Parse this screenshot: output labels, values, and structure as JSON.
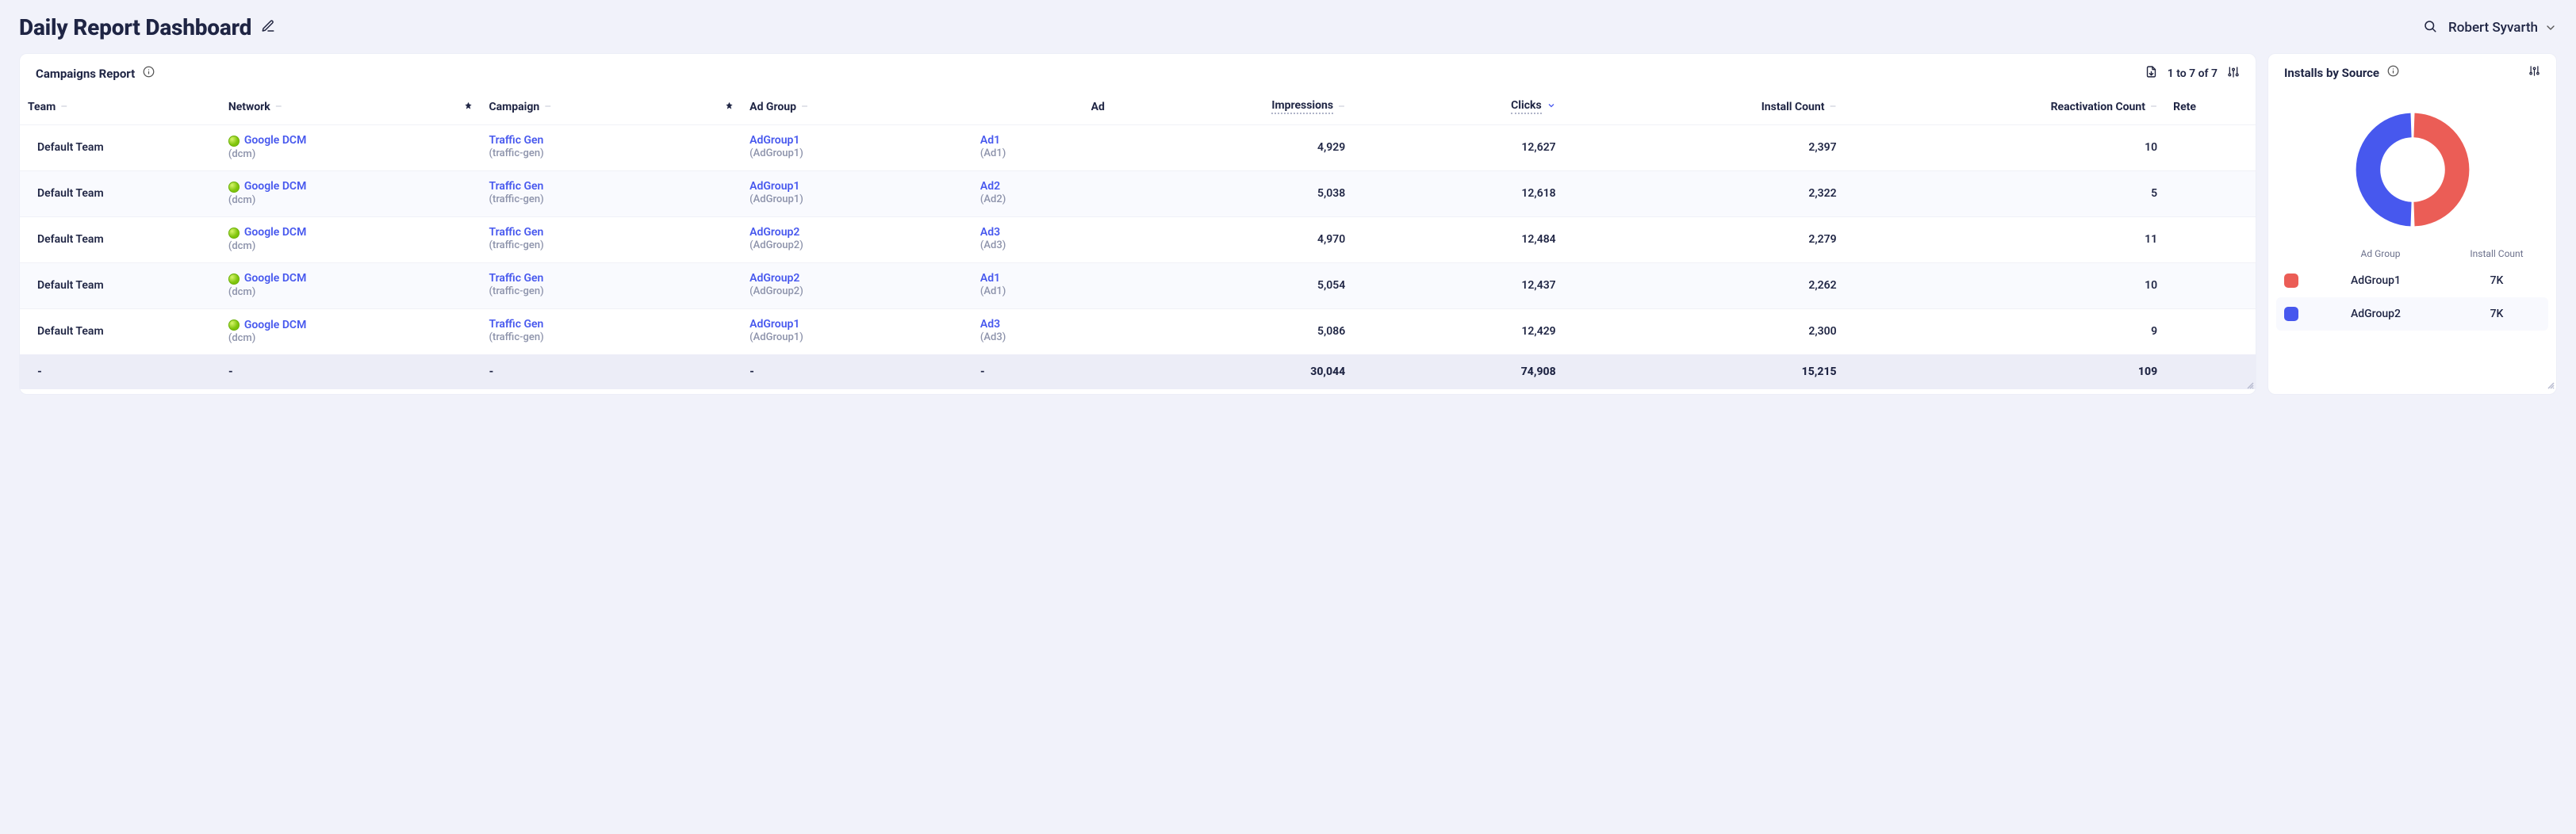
{
  "header": {
    "title": "Daily Report Dashboard",
    "user_name": "Robert Syvarth"
  },
  "campaigns_card": {
    "title": "Campaigns Report",
    "count_text": "1 to 7 of 7",
    "columns": {
      "team": "Team",
      "network": "Network",
      "campaign": "Campaign",
      "adgroup": "Ad Group",
      "ad": "Ad",
      "impressions": "Impressions",
      "clicks": "Clicks",
      "install": "Install Count",
      "reactivation": "Reactivation Count",
      "retention_partial": "Rete"
    },
    "rows": [
      {
        "team": "Default Team",
        "network": "Google DCM",
        "network_sub": "(dcm)",
        "campaign": "Traffic Gen",
        "campaign_sub": "(traffic-gen)",
        "adgroup": "AdGroup1",
        "adgroup_sub": "(AdGroup1)",
        "ad": "Ad1",
        "ad_sub": "(Ad1)",
        "impressions": "4,929",
        "clicks": "12,627",
        "install": "2,397",
        "reactivation": "10"
      },
      {
        "team": "Default Team",
        "network": "Google DCM",
        "network_sub": "(dcm)",
        "campaign": "Traffic Gen",
        "campaign_sub": "(traffic-gen)",
        "adgroup": "AdGroup1",
        "adgroup_sub": "(AdGroup1)",
        "ad": "Ad2",
        "ad_sub": "(Ad2)",
        "impressions": "5,038",
        "clicks": "12,618",
        "install": "2,322",
        "reactivation": "5"
      },
      {
        "team": "Default Team",
        "network": "Google DCM",
        "network_sub": "(dcm)",
        "campaign": "Traffic Gen",
        "campaign_sub": "(traffic-gen)",
        "adgroup": "AdGroup2",
        "adgroup_sub": "(AdGroup2)",
        "ad": "Ad3",
        "ad_sub": "(Ad3)",
        "impressions": "4,970",
        "clicks": "12,484",
        "install": "2,279",
        "reactivation": "11"
      },
      {
        "team": "Default Team",
        "network": "Google DCM",
        "network_sub": "(dcm)",
        "campaign": "Traffic Gen",
        "campaign_sub": "(traffic-gen)",
        "adgroup": "AdGroup2",
        "adgroup_sub": "(AdGroup2)",
        "ad": "Ad1",
        "ad_sub": "(Ad1)",
        "impressions": "5,054",
        "clicks": "12,437",
        "install": "2,262",
        "reactivation": "10"
      },
      {
        "team": "Default Team",
        "network": "Google DCM",
        "network_sub": "(dcm)",
        "campaign": "Traffic Gen",
        "campaign_sub": "(traffic-gen)",
        "adgroup": "AdGroup1",
        "adgroup_sub": "(AdGroup1)",
        "ad": "Ad3",
        "ad_sub": "(Ad3)",
        "impressions": "5,086",
        "clicks": "12,429",
        "install": "2,300",
        "reactivation": "9"
      }
    ],
    "totals": {
      "team": "-",
      "network": "-",
      "campaign": "-",
      "adgroup": "-",
      "ad": "-",
      "impressions": "30,044",
      "clicks": "74,908",
      "install": "15,215",
      "reactivation": "109"
    }
  },
  "installs_card": {
    "title": "Installs by Source",
    "legend_headers": {
      "adgroup": "Ad Group",
      "install": "Install Count"
    },
    "legend": [
      {
        "label": "AdGroup1",
        "value": "7K",
        "color": "#eb5d56"
      },
      {
        "label": "AdGroup2",
        "value": "7K",
        "color": "#4758ee"
      }
    ]
  },
  "chart_data": {
    "type": "pie",
    "title": "Installs by Source",
    "categories": [
      "AdGroup1",
      "AdGroup2"
    ],
    "values": [
      7000,
      7000
    ],
    "colors": [
      "#eb5d56",
      "#4758ee"
    ]
  }
}
